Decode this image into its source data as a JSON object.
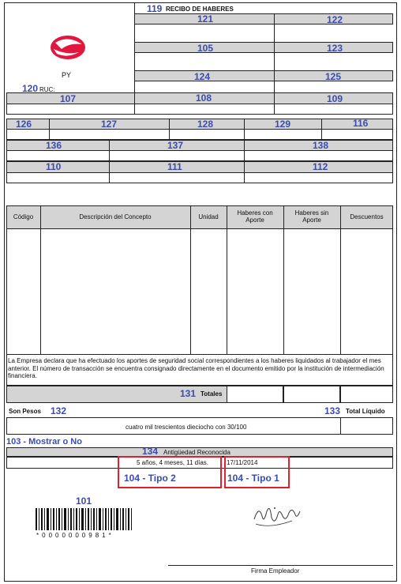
{
  "header": {
    "num_119": "119",
    "title": "RECIBO DE HABERES",
    "country": "PY",
    "num_120": "120",
    "ruc_label": "RUC:"
  },
  "right_fields": [
    "121",
    "122",
    "105",
    "123",
    "124",
    "125"
  ],
  "row1": [
    "107",
    "108",
    "109"
  ],
  "row2": [
    "126",
    "127",
    "128",
    "129",
    "116"
  ],
  "row3": [
    "136",
    "137",
    "138"
  ],
  "row4": [
    "110",
    "111",
    "112"
  ],
  "table": {
    "headers": {
      "codigo": "Código",
      "descripcion": "Descripción del Concepto",
      "unidad": "Unidad",
      "haberes_con": "Haberes con Aporte",
      "haberes_sin": "Haberes sin Aporte",
      "descuentos": "Descuentos"
    },
    "declaration": "La Empresa declara que ha efectuado los aportes de seguridad social correspondientes a los haberes liquidados al trabajador el mes anterior. El número de transacción se encuentra consignado directamente en el documento emitido por la institución de intermediación financiera.",
    "totales_num": "131",
    "totales_label": "Totales"
  },
  "son_pesos": {
    "label": "Son Pesos",
    "num": "132",
    "num_133": "133",
    "total_label": "Total Líquido",
    "amount_text": "cuatro mil trescientos dieciocho con 30/100"
  },
  "show_label": "103 - Mostrar o No",
  "antiguedad": {
    "num": "134",
    "label": "Antigüedad Reconocida",
    "value": "5 años, 4 meses, 11 días.",
    "date": "17/11/2014",
    "tipo2": "104 - Tipo 2",
    "tipo1": "104 - Tipo 1"
  },
  "barcode": {
    "num": "101",
    "text": "*0000000981*"
  },
  "signature": {
    "label": "Firma Empleador"
  },
  "colors": {
    "accent": "#3a4bb0",
    "logo": "#e3173e",
    "highlight": "#e0202a"
  }
}
